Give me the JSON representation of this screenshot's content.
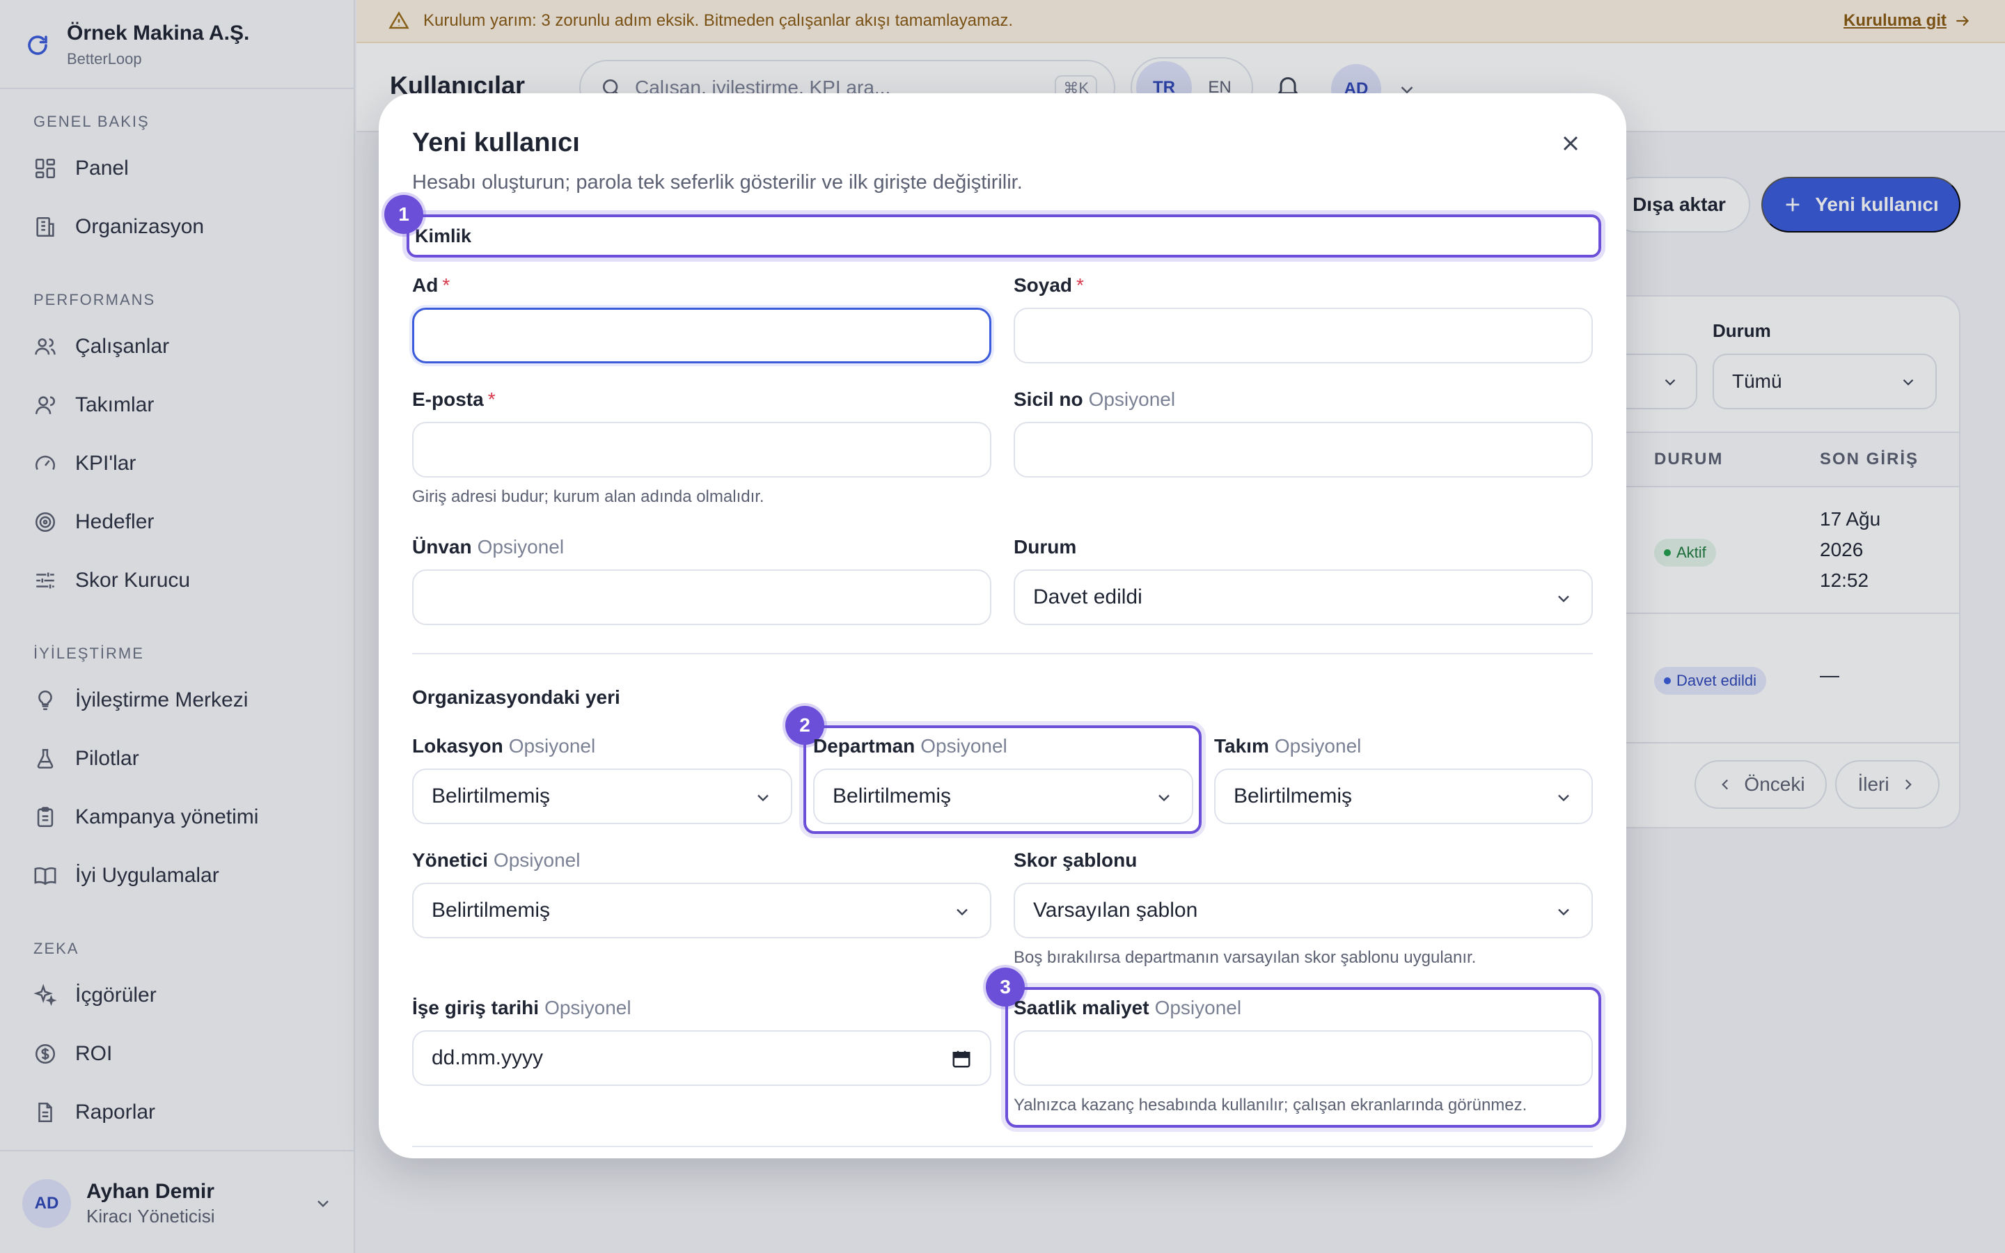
{
  "banner": {
    "message": "Kurulum yarım: 3 zorunlu adım eksik. Bitmeden çalışanlar akışı tamamlayamaz.",
    "link": "Kuruluma git"
  },
  "brand": {
    "name": "Örnek Makina A.Ş.",
    "sub": "BetterLoop"
  },
  "sidebar": {
    "sections": [
      {
        "title": "GENEL BAKIŞ",
        "items": [
          {
            "label": "Panel",
            "icon": "dashboard-icon"
          },
          {
            "label": "Organizasyon",
            "icon": "building-icon"
          }
        ]
      },
      {
        "title": "PERFORMANS",
        "items": [
          {
            "label": "Çalışanlar",
            "icon": "users-icon"
          },
          {
            "label": "Takımlar",
            "icon": "team-icon"
          },
          {
            "label": "KPI'lar",
            "icon": "gauge-icon"
          },
          {
            "label": "Hedefler",
            "icon": "target-icon"
          },
          {
            "label": "Skor Kurucu",
            "icon": "sliders-icon"
          }
        ]
      },
      {
        "title": "İYİLEŞTİRME",
        "items": [
          {
            "label": "İyileştirme Merkezi",
            "icon": "lightbulb-icon"
          },
          {
            "label": "Pilotlar",
            "icon": "flask-icon"
          },
          {
            "label": "Kampanya yönetimi",
            "icon": "clipboard-icon"
          },
          {
            "label": "İyi Uygulamalar",
            "icon": "book-icon"
          }
        ]
      },
      {
        "title": "ZEKA",
        "items": [
          {
            "label": "İçgörüler",
            "icon": "sparkles-icon"
          },
          {
            "label": "ROI",
            "icon": "dollar-icon"
          },
          {
            "label": "Raporlar",
            "icon": "file-icon"
          }
        ]
      }
    ],
    "user": {
      "initials": "AD",
      "name": "Ayhan Demir",
      "role": "Kiracı Yöneticisi"
    }
  },
  "header": {
    "title": "Kullanıcılar",
    "search_placeholder": "Çalışan, iyileştirme, KPI ara...",
    "search_shortcut": "⌘K",
    "lang_tr": "TR",
    "lang_en": "EN",
    "avatar": "AD"
  },
  "page": {
    "export_label": "Dışa aktar",
    "new_user_label": "Yeni kullanıcı",
    "filter_status_label": "Durum",
    "filter_status_value": "Tümü",
    "col_status": "DURUM",
    "col_last_login": "SON GİRİŞ",
    "rows": [
      {
        "status": "Aktif",
        "last_login": [
          "17 Ağu",
          "2026",
          "12:52"
        ]
      },
      {
        "status": "Davet edildi",
        "last_login": [
          "—"
        ]
      }
    ],
    "prev_label": "Önceki",
    "next_label": "İleri"
  },
  "modal": {
    "title": "Yeni kullanıcı",
    "subtitle": "Hesabı oluşturun; parola tek seferlik gösterilir ve ilk girişte değiştirilir.",
    "identity_section": "Kimlik",
    "optional": "Opsiyonel",
    "required_mark": "*",
    "fields": {
      "first_name": {
        "label": "Ad",
        "value": ""
      },
      "last_name": {
        "label": "Soyad",
        "value": ""
      },
      "email": {
        "label": "E-posta",
        "value": "",
        "help": "Giriş adresi budur; kurum alan adında olmalıdır."
      },
      "employee_no": {
        "label": "Sicil no",
        "value": ""
      },
      "title": {
        "label": "Ünvan",
        "value": ""
      },
      "status": {
        "label": "Durum",
        "value": "Davet edildi"
      },
      "location": {
        "label": "Lokasyon",
        "value": "Belirtilmemiş"
      },
      "department": {
        "label": "Departman",
        "value": "Belirtilmemiş"
      },
      "team": {
        "label": "Takım",
        "value": "Belirtilmemiş"
      },
      "manager": {
        "label": "Yönetici",
        "value": "Belirtilmemiş"
      },
      "score_template": {
        "label": "Skor şablonu",
        "value": "Varsayılan şablon",
        "help": "Boş bırakılırsa departmanın varsayılan skor şablonu uygulanır."
      },
      "start_date": {
        "label": "İşe giriş tarihi",
        "placeholder": "dd.mm.yyyy"
      },
      "hourly_cost": {
        "label": "Saatlik maliyet",
        "value": "",
        "help": "Yalnızca kazanç hesabında kullanılır; çalışan ekranlarında görünmez."
      }
    },
    "org_section": "Organizasyondaki yeri",
    "steps": [
      "1",
      "2",
      "3"
    ]
  }
}
